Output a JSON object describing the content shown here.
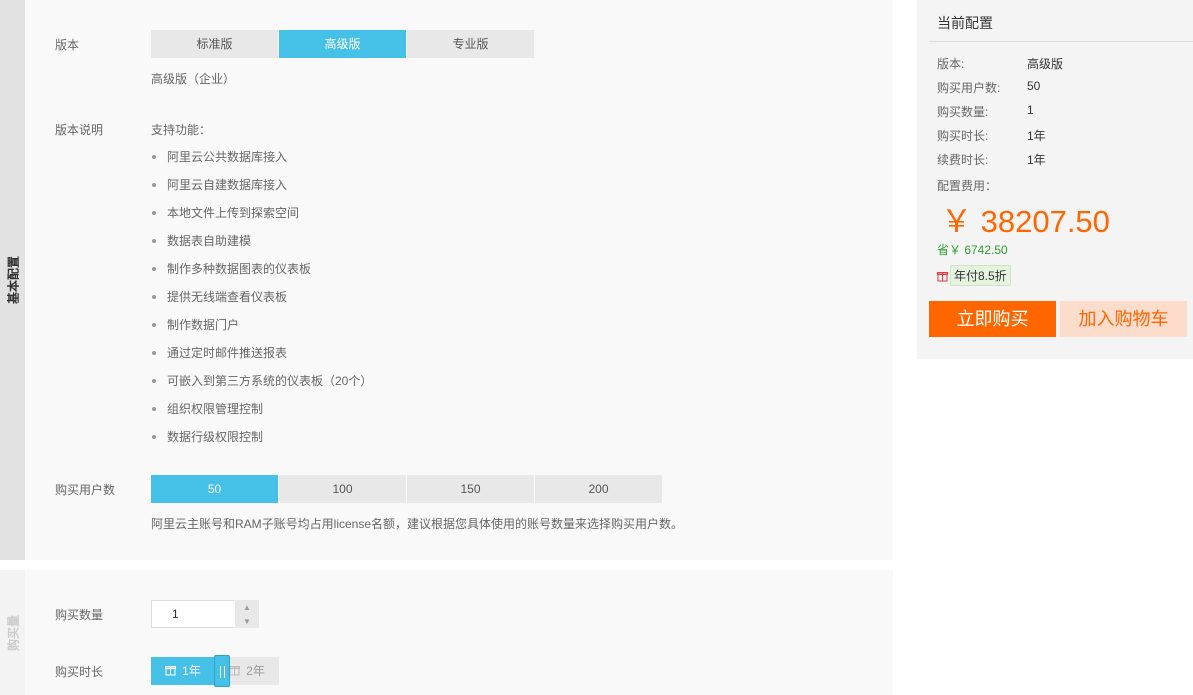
{
  "tabs": {
    "basic": "基本配置",
    "quantity": "购买量"
  },
  "edition": {
    "label": "版本",
    "options": [
      "标准版",
      "高级版",
      "专业版"
    ],
    "selected": "高级版",
    "desc": "高级版（企业）"
  },
  "features": {
    "label": "版本说明",
    "title": "支持功能：",
    "items": [
      "阿里云公共数据库接入",
      "阿里云自建数据库接入",
      "本地文件上传到探索空间",
      "数据表自助建模",
      "制作多种数据图表的仪表板",
      "提供无线端查看仪表板",
      "制作数据门户",
      "通过定时邮件推送报表",
      "可嵌入到第三方系统的仪表板（20个）",
      "组织权限管理控制",
      "数据行级权限控制"
    ]
  },
  "users": {
    "label": "购买用户数",
    "options": [
      "50",
      "100",
      "150",
      "200"
    ],
    "selected": "50",
    "note": "阿里云主账号和RAM子账号均占用license名额，建议根据您具体使用的账号数量来选择购买用户数。"
  },
  "quantity": {
    "label": "购买数量",
    "value": "1"
  },
  "duration": {
    "label": "购买时长",
    "options": [
      "1年",
      "2年"
    ],
    "selected": "1年"
  },
  "summary": {
    "title": "当前配置",
    "rows": [
      {
        "k": "版本:",
        "v": "高级版"
      },
      {
        "k": "购买用户数:",
        "v": "50"
      },
      {
        "k": "购买数量:",
        "v": "1"
      },
      {
        "k": "购买时长:",
        "v": "1年"
      },
      {
        "k": "续费时长:",
        "v": "1年"
      }
    ],
    "fee_label": "配置费用：",
    "price": "￥ 38207.50",
    "save": "省￥ 6742.50",
    "promo": "年付8.5折",
    "buy_label": "立即购买",
    "cart_label": "加入购物车"
  },
  "colors": {
    "accent": "#45c0e6",
    "orange": "#ff6600",
    "save_green": "#2e9e2e"
  }
}
